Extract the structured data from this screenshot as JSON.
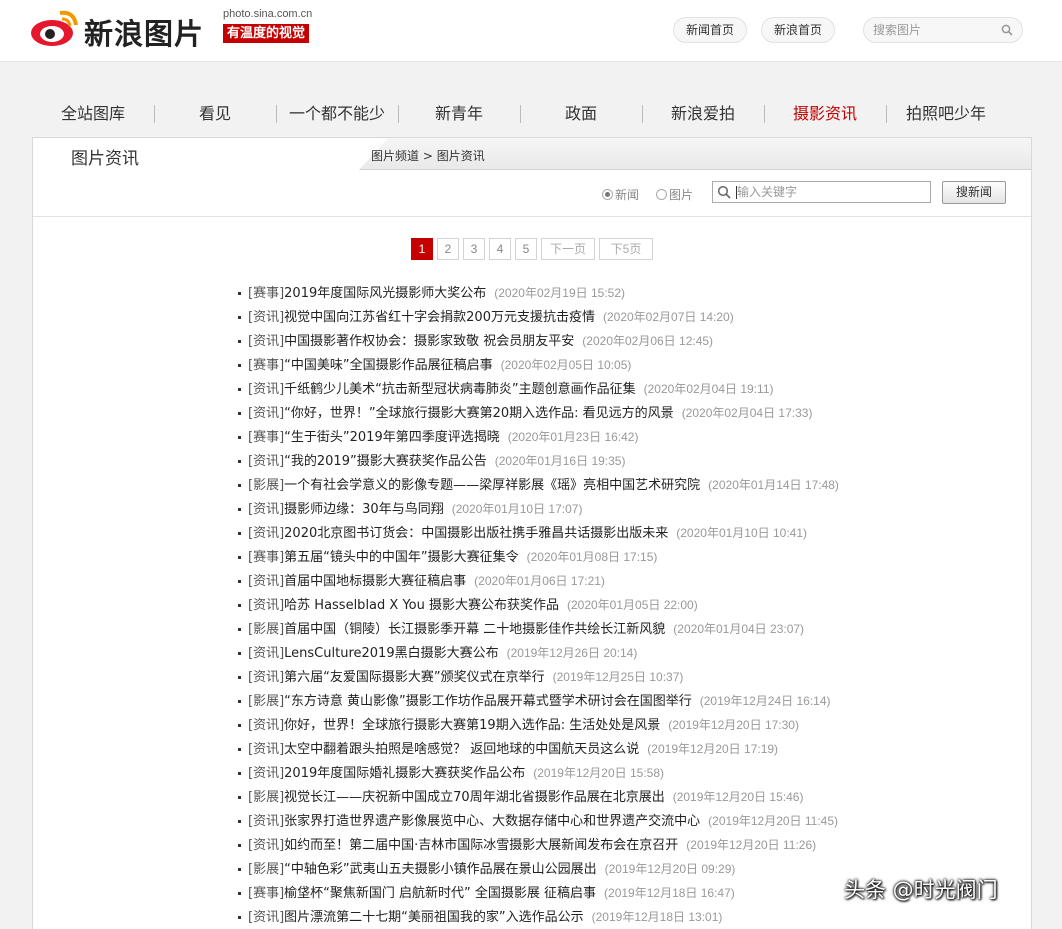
{
  "header": {
    "logo_text": "新浪图片",
    "logo_url": "photo.sina.com.cn",
    "logo_slogan": "有温度的视觉",
    "links": [
      "新闻首页",
      "新浪首页"
    ],
    "search_placeholder": "搜索图片"
  },
  "nav": {
    "items": [
      "全站图库",
      "看见",
      "一个都不能少",
      "新青年",
      "政面",
      "新浪爱拍",
      "摄影资讯",
      "拍照吧少年"
    ],
    "active": "摄影资讯",
    "active_color": "#c40000"
  },
  "panel": {
    "title": "图片资讯",
    "breadcrumb": [
      "图片频道",
      ">",
      "图片资讯"
    ],
    "radio_news": "新闻",
    "radio_pic": "图片",
    "selected": "新闻",
    "keyword_placeholder": "输入关键字",
    "search_button": "搜新闻"
  },
  "pagination": {
    "pages": [
      "1",
      "2",
      "3",
      "4",
      "5"
    ],
    "current": "1",
    "next": "下一页",
    "next5": "下5页"
  },
  "news": [
    {
      "cat": "[赛事]",
      "title": "2019年度国际风光摄影师大奖公布",
      "time": "(2020年02月19日 15:52)"
    },
    {
      "cat": "[资讯]",
      "title": "视觉中国向江苏省红十字会捐款200万元支援抗击疫情",
      "time": "(2020年02月07日 14:20)"
    },
    {
      "cat": "[资讯]",
      "title": "中国摄影著作权协会：摄影家致敬 祝会员朋友平安",
      "time": "(2020年02月06日 12:45)"
    },
    {
      "cat": "[赛事]",
      "title": "“中国美味”全国摄影作品展征稿启事",
      "time": "(2020年02月05日 10:05)"
    },
    {
      "cat": "[资讯]",
      "title": "千纸鹤少儿美术“抗击新型冠状病毒肺炎”主题创意画作品征集",
      "time": "(2020年02月04日 19:11)"
    },
    {
      "cat": "[资讯]",
      "title": "“你好，世界！”全球旅行摄影大赛第20期入选作品: 看见远方的风景",
      "time": "(2020年02月04日 17:33)"
    },
    {
      "cat": "[赛事]",
      "title": "“生于街头”2019年第四季度评选揭晓",
      "time": "(2020年01月23日 16:42)"
    },
    {
      "cat": "[资讯]",
      "title": "“我的2019”摄影大赛获奖作品公告",
      "time": "(2020年01月16日 19:35)"
    },
    {
      "cat": "[影展]",
      "title": "一个有社会学意义的影像专题——梁厚祥影展《瑶》亮相中国艺术研究院",
      "time": "(2020年01月14日 17:48)"
    },
    {
      "cat": "[资讯]",
      "title": "摄影师边缘：30年与鸟同翔",
      "time": "(2020年01月10日 17:07)"
    },
    {
      "cat": "[资讯]",
      "title": "2020北京图书订货会：中国摄影出版社携手雅昌共话摄影出版未来",
      "time": "(2020年01月10日 10:41)"
    },
    {
      "cat": "[赛事]",
      "title": "第五届“镜头中的中国年”摄影大赛征集令",
      "time": "(2020年01月08日 17:15)"
    },
    {
      "cat": "[资讯]",
      "title": "首届中国地标摄影大赛征稿启事",
      "time": "(2020年01月06日 17:21)"
    },
    {
      "cat": "[资讯]",
      "title": "哈苏 Hasselblad X You 摄影大赛公布获奖作品",
      "time": "(2020年01月05日 22:00)"
    },
    {
      "cat": "[影展]",
      "title": "首届中国（铜陵）长江摄影季开幕 二十地摄影佳作共绘长江新风貌",
      "time": "(2020年01月04日 23:07)"
    },
    {
      "cat": "[资讯]",
      "title": "LensCulture2019黑白摄影大赛公布",
      "time": "(2019年12月26日 20:14)"
    },
    {
      "cat": "[资讯]",
      "title": "第六届“友爱国际摄影大赛”颁奖仪式在京举行",
      "time": "(2019年12月25日 10:37)"
    },
    {
      "cat": "[影展]",
      "title": "“东方诗意 黄山影像”摄影工作坊作品展开幕式暨学术研讨会在国图举行",
      "time": "(2019年12月24日 16:14)"
    },
    {
      "cat": "[资讯]",
      "title": "你好，世界！全球旅行摄影大赛第19期入选作品: 生活处处是风景",
      "time": "(2019年12月20日 17:30)"
    },
    {
      "cat": "[资讯]",
      "title": "太空中翻着跟头拍照是啥感觉？ 返回地球的中国航天员这么说",
      "time": "(2019年12月20日 17:19)"
    },
    {
      "cat": "[资讯]",
      "title": "2019年度国际婚礼摄影大赛获奖作品公布",
      "time": "(2019年12月20日 15:58)"
    },
    {
      "cat": "[影展]",
      "title": "视觉长江——庆祝新中国成立70周年湖北省摄影作品展在北京展出",
      "time": "(2019年12月20日 15:46)"
    },
    {
      "cat": "[资讯]",
      "title": "张家界打造世界遗产影像展览中心、大数据存储中心和世界遗产交流中心",
      "time": "(2019年12月20日 11:45)"
    },
    {
      "cat": "[资讯]",
      "title": "如约而至！第二届中国·吉林市国际冰雪摄影大展新闻发布会在京召开",
      "time": "(2019年12月20日 11:26)"
    },
    {
      "cat": "[影展]",
      "title": "“中轴色彩”武夷山五夫摄影小镇作品展在景山公园展出",
      "time": "(2019年12月20日 09:29)"
    },
    {
      "cat": "[赛事]",
      "title": "榆垡杯“聚焦新国门 启航新时代” 全国摄影展 征稿启事",
      "time": "(2019年12月18日 16:47)"
    },
    {
      "cat": "[资讯]",
      "title": "图片漂流第二十七期“美丽祖国我的家”入选作品公示",
      "time": "(2019年12月18日 13:01)"
    }
  ],
  "watermark": "头条 @时光阀门"
}
